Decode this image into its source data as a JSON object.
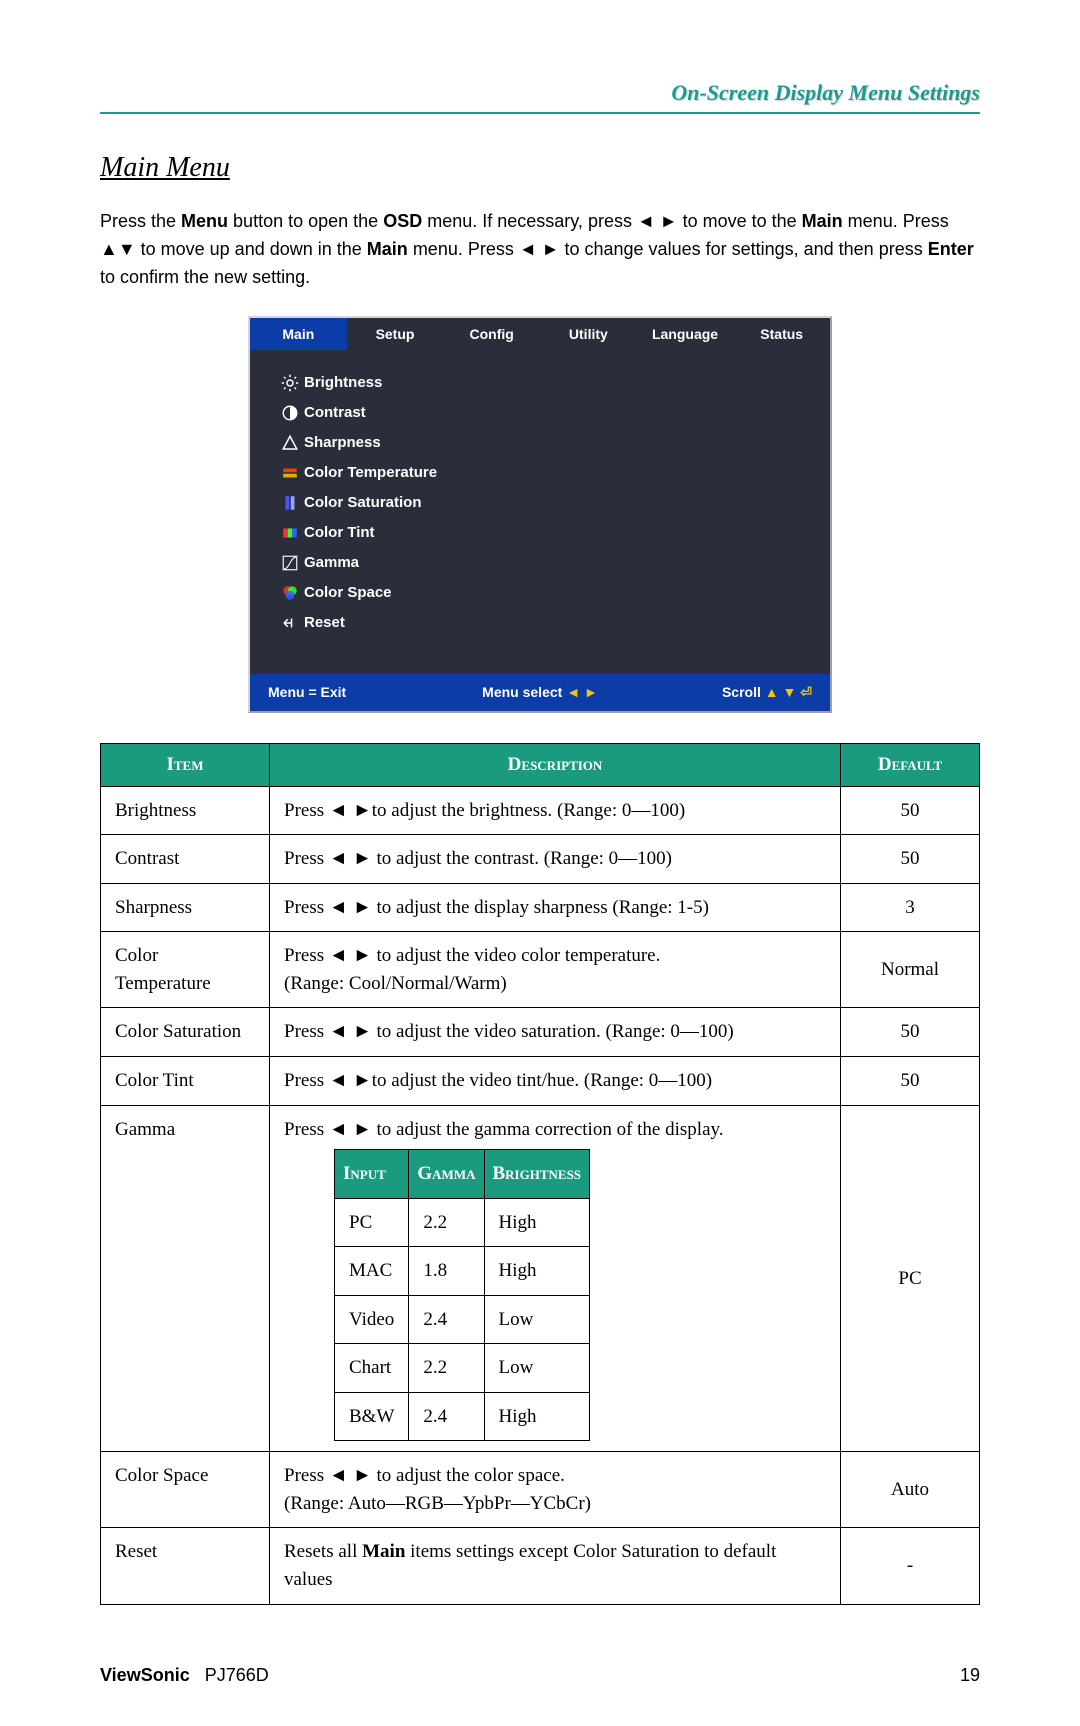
{
  "header_title": "On-Screen Display Menu Settings",
  "section_title": "Main Menu",
  "intro_parts": {
    "p1a": "Press the ",
    "menu": "Menu",
    "p1b": " button to open the ",
    "osd": "OSD",
    "p1c": " menu. If necessary, press ◄ ► to move to the ",
    "main1": "Main",
    "p1d": " menu. Press ▲▼ to move up and down in the ",
    "main2": "Main",
    "p1e": " menu. Press ◄ ► to change values for settings, and then press ",
    "enter": "Enter",
    "p1f": " to confirm the new setting."
  },
  "osd": {
    "tabs": [
      "Main",
      "Setup",
      "Config",
      "Utility",
      "Language",
      "Status"
    ],
    "selected_tab_index": 0,
    "items": [
      {
        "icon": "brightness",
        "label": "Brightness"
      },
      {
        "icon": "contrast",
        "label": "Contrast"
      },
      {
        "icon": "sharpness",
        "label": "Sharpness"
      },
      {
        "icon": "colortemp",
        "label": "Color Temperature"
      },
      {
        "icon": "saturation",
        "label": "Color Saturation"
      },
      {
        "icon": "tint",
        "label": "Color Tint"
      },
      {
        "icon": "gamma",
        "label": "Gamma"
      },
      {
        "icon": "colorspace",
        "label": "Color Space"
      },
      {
        "icon": "reset",
        "label": "Reset"
      }
    ],
    "foot_left": "Menu = Exit",
    "foot_center": "Menu select",
    "foot_center_icons": " ◄ ►",
    "foot_right": "Scroll",
    "foot_right_icons": " ▲ ▼ ⏎"
  },
  "table": {
    "headers": {
      "item": "Item",
      "desc": "Description",
      "def": "Default"
    },
    "arrow": "◄ ►",
    "rows": [
      {
        "item": "Brightness",
        "desc_pre": "Press ",
        "desc_post": "to adjust the brightness. (Range: 0—100)",
        "def": "50"
      },
      {
        "item": "Contrast",
        "desc_pre": "Press ",
        "desc_post": " to adjust the contrast. (Range: 0—100)",
        "def": "50"
      },
      {
        "item": "Sharpness",
        "desc_pre": "Press ",
        "desc_post": " to adjust the display sharpness (Range: 1-5)",
        "def": "3"
      },
      {
        "item": "Color Temperature",
        "desc_pre": "Press ",
        "desc_post": " to adjust the video color temperature.",
        "desc_line2": "(Range: Cool/Normal/Warm)",
        "def": "Normal"
      },
      {
        "item": "Color Saturation",
        "desc_pre": "Press ",
        "desc_post": " to adjust the video saturation. (Range: 0—100)",
        "def": "50"
      },
      {
        "item": "Color Tint",
        "desc_pre": "Press ",
        "desc_post": "to adjust the video tint/hue. (Range: 0—100)",
        "def": "50"
      }
    ],
    "gamma": {
      "item": "Gamma",
      "desc_pre": "Press ",
      "desc_post": " to adjust the gamma correction of the display.",
      "def": "PC",
      "sub_headers": [
        "Input",
        "Gamma",
        "Brightness"
      ],
      "sub_rows": [
        [
          "PC",
          "2.2",
          "High"
        ],
        [
          "MAC",
          "1.8",
          "High"
        ],
        [
          "Video",
          "2.4",
          "Low"
        ],
        [
          "Chart",
          "2.2",
          "Low"
        ],
        [
          "B&W",
          "2.4",
          "High"
        ]
      ]
    },
    "colorspace": {
      "item": "Color Space",
      "desc_pre": "Press ",
      "desc_post": " to adjust the color space.",
      "desc_line2": "(Range: Auto—RGB—YpbPr—YCbCr)",
      "def": "Auto"
    },
    "reset": {
      "item": "Reset",
      "desc_a": "Resets all ",
      "desc_bold": "Main",
      "desc_b": " items settings except Color Saturation to default values",
      "def": "-"
    }
  },
  "footer": {
    "brand": "ViewSonic",
    "model": "PJ766D",
    "page": "19"
  }
}
